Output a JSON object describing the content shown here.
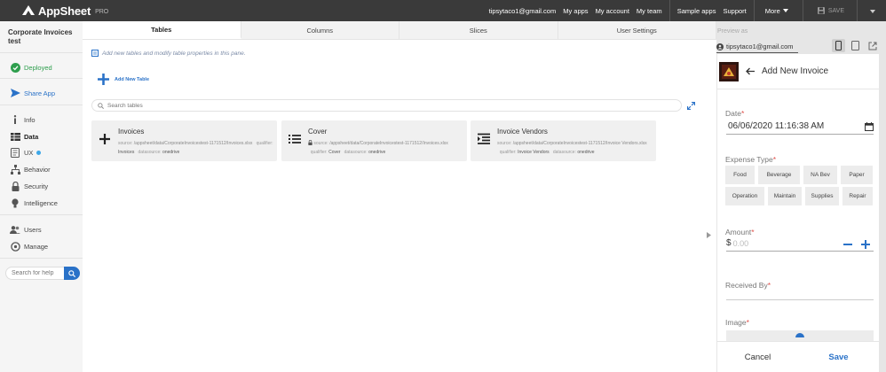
{
  "brand": {
    "name": "AppSheet",
    "tier": "PRO"
  },
  "topnav": {
    "email": "tipsytaco1@gmail.com",
    "my_apps": "My apps",
    "my_account": "My account",
    "my_team": "My team",
    "sample_apps": "Sample apps",
    "support": "Support",
    "more": "More",
    "save": "SAVE"
  },
  "sidebar": {
    "app_name": "Corporate Invoices test",
    "deployed": "Deployed",
    "share_app": "Share App",
    "items": [
      {
        "label": "Info",
        "icon": "info-icon"
      },
      {
        "label": "Data",
        "icon": "table-icon"
      },
      {
        "label": "UX",
        "icon": "ux-icon"
      },
      {
        "label": "Behavior",
        "icon": "behavior-icon"
      },
      {
        "label": "Security",
        "icon": "lock-icon"
      },
      {
        "label": "Intelligence",
        "icon": "bulb-icon"
      },
      {
        "label": "Users",
        "icon": "users-icon"
      },
      {
        "label": "Manage",
        "icon": "manage-icon"
      }
    ],
    "help_placeholder": "Search for help"
  },
  "main": {
    "tabs": [
      {
        "label": "Tables",
        "active": true
      },
      {
        "label": "Columns"
      },
      {
        "label": "Slices"
      },
      {
        "label": "User Settings"
      }
    ],
    "hint": "Add new tables and modify table properties in this pane.",
    "add_table": "Add New Table",
    "search_placeholder": "Search tables",
    "cards": [
      {
        "title": "Invoices",
        "icon": "plus-icon",
        "source_label": "source:",
        "source": "/appsheet/data/CorporateInvoicestest-1171512/Invoices.xlsx",
        "qualifier_label": "qualifier:",
        "qualifier": "Invoices",
        "datasource_label": "datasource:",
        "datasource": "onedrive"
      },
      {
        "title": "Cover",
        "icon": "list-icon",
        "source_label": "source:",
        "source": "/appsheet/data/CorporateInvoicestest-1171512/Invoices.xlsx",
        "qualifier_label": "qualifier:",
        "qualifier": "Cover",
        "datasource_label": "datasource:",
        "datasource": "onedrive"
      },
      {
        "title": "Invoice Vendors",
        "icon": "indent-icon",
        "source_label": "source:",
        "source": "/appsheet/data/CorporateInvoicestest-1171512/Invoice Vendors.xlsx",
        "qualifier_label": "qualifier:",
        "qualifier": "Invoice Vendors",
        "datasource_label": "datasource:",
        "datasource": "onedrive"
      }
    ]
  },
  "preview": {
    "label": "Preview as",
    "user": "tipsytaco1@gmail.com",
    "form_title": "Add New Invoice",
    "date_label": "Date",
    "date_value": "06/06/2020 11:16:38 AM",
    "expense_label": "Expense Type",
    "expense_row1": [
      "Food",
      "Beverage",
      "NA Bev",
      "Paper"
    ],
    "expense_row2": [
      "Operation",
      "Maintain",
      "Supplies",
      "Repair"
    ],
    "amount_label": "Amount",
    "amount_currency": "$",
    "amount_placeholder": "0.00",
    "received_label": "Received By",
    "image_label": "Image",
    "cancel": "Cancel",
    "save": "Save"
  },
  "colors": {
    "accent": "#2a72c8",
    "topbar": "#3a3a3a",
    "deployed": "#2e9e4d",
    "required": "#e0504a"
  }
}
